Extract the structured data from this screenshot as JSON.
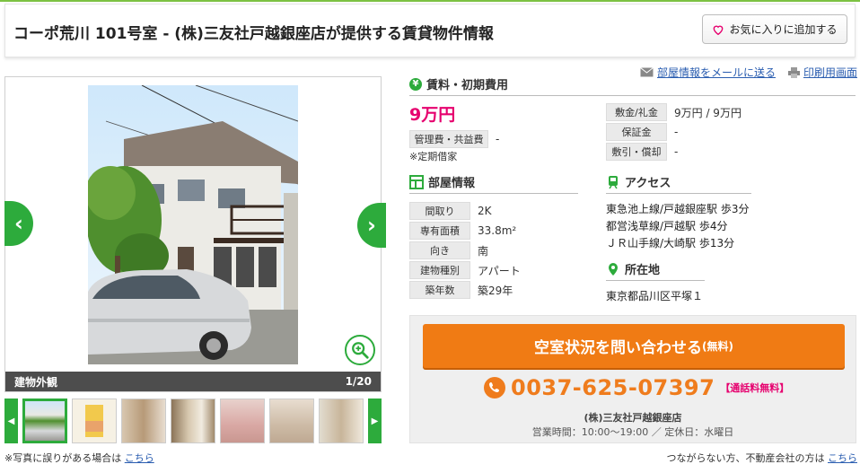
{
  "page": {
    "title": "コーポ荒川 101号室 - (株)三友社戸越銀座店が提供する賃貸物件情報",
    "favorite_label": "お気に入りに追加する"
  },
  "top_links": {
    "mail": "部屋情報をメールに送る",
    "print": "印刷用画面"
  },
  "gallery": {
    "caption": "建物外観",
    "counter": "1/20",
    "thumbnail_count": 7
  },
  "photo_note": {
    "text": "※写真に誤りがある場合は",
    "link": "こちら"
  },
  "rent": {
    "heading": "賃料・初期費用",
    "amount": "9万円",
    "mgmt_label": "管理費・共益費",
    "mgmt_value": "-",
    "note": "※定期借家",
    "deposit_label": "敷金/礼金",
    "deposit_value": "9万円 / 9万円",
    "guarantee_label": "保証金",
    "guarantee_value": "-",
    "amort_label": "敷引・償却",
    "amort_value": "-"
  },
  "room": {
    "heading": "部屋情報",
    "rows": [
      {
        "label": "間取り",
        "value": "2K"
      },
      {
        "label": "専有面積",
        "value": "33.8m²"
      },
      {
        "label": "向き",
        "value": "南"
      },
      {
        "label": "建物種別",
        "value": "アパート"
      },
      {
        "label": "築年数",
        "value": "築29年"
      }
    ]
  },
  "access": {
    "heading": "アクセス",
    "lines": [
      "東急池上線/戸越銀座駅 歩3分",
      "都営浅草線/戸越駅 歩4分",
      "ＪＲ山手線/大崎駅 歩13分"
    ]
  },
  "location": {
    "heading": "所在地",
    "address": "東京都品川区平塚１"
  },
  "contact": {
    "cta_label": "空室状況を問い合わせる",
    "cta_suffix": "(無料)",
    "phone": "0037-625-07397",
    "free_call": "【通話料無料】",
    "company": "(株)三友社戸越銀座店",
    "hours": "営業時間：10:00～19:00 ／ 定休日：水曜日"
  },
  "footer_note": {
    "text": "つながらない方、不動産会社の方は",
    "link": "こちら"
  },
  "colors": {
    "brand_green": "#2dab3c",
    "cta_orange": "#f07b14",
    "price_pink": "#e6006e"
  }
}
